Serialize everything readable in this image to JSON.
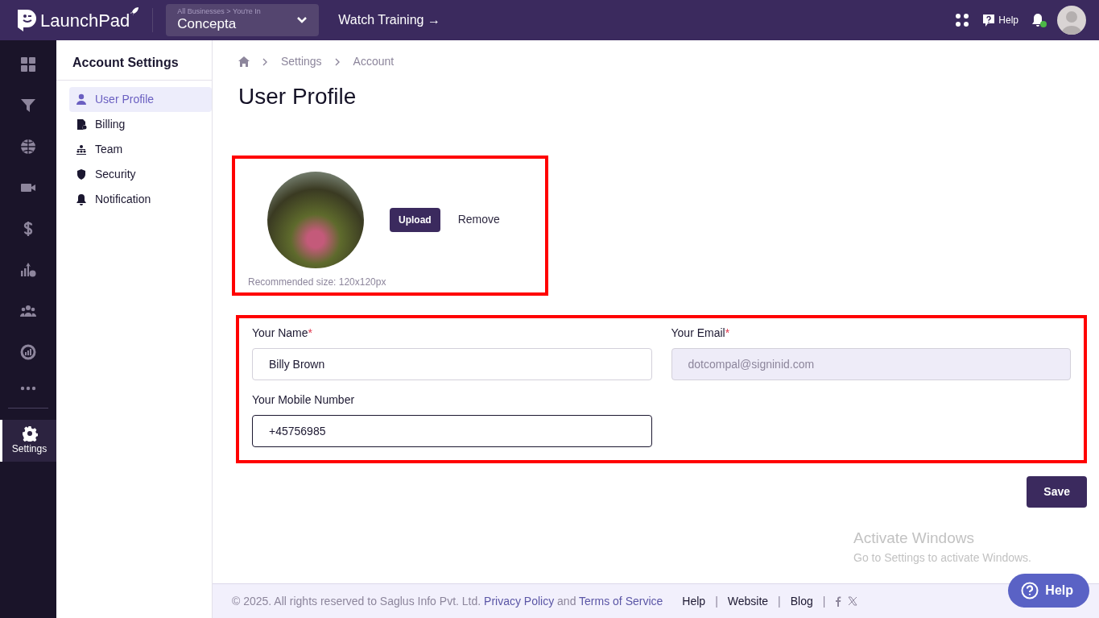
{
  "topbar": {
    "brand": "LaunchPad",
    "business_switcher": {
      "caption": "All Businesses > You're In",
      "value": "Concepta"
    },
    "training_link": "Watch Training →",
    "help": "Help",
    "notification_dot": true
  },
  "rail": {
    "items": [
      {
        "selected": false
      },
      {
        "selected": false
      },
      {
        "selected": false
      },
      {
        "selected": false
      },
      {
        "selected": false
      },
      {
        "selected": false
      },
      {
        "selected": false
      },
      {
        "selected": false
      },
      {
        "selected": false
      }
    ],
    "settings": {
      "label": "Settings",
      "selected": true
    }
  },
  "settings_menu": {
    "title": "Account Settings",
    "items": [
      {
        "label": "User Profile",
        "selected": true
      },
      {
        "label": "Billing",
        "selected": false
      },
      {
        "label": "Team",
        "selected": false
      },
      {
        "label": "Security",
        "selected": false
      },
      {
        "label": "Notification",
        "selected": false
      }
    ]
  },
  "breadcrumb": [
    "Settings",
    "Account"
  ],
  "page_title": "User Profile",
  "photo": {
    "upload": "Upload",
    "remove": "Remove",
    "hint": "Recommended size: 120x120px"
  },
  "form": {
    "required_marker": "*",
    "fields": [
      {
        "label": "Your Name",
        "required": true,
        "value": "Billy Brown",
        "disabled": false
      },
      {
        "label": "Your Email",
        "required": true,
        "value": "dotcompal@signinid.com",
        "disabled": true
      },
      {
        "label": "Your Mobile Number",
        "required": false,
        "value": "+45756985",
        "disabled": false
      }
    ],
    "save": "Save"
  },
  "os_notice": {
    "title": "Activate Windows",
    "text": "Go to Settings to activate Windows."
  },
  "footer": {
    "copyright": "©  2025. All rights reserved to Saglus Info Pvt. Ltd.",
    "privacy": "Privacy Policy",
    "and": "and",
    "terms": "Terms of Service",
    "links": [
      "Help",
      "Website",
      "Blog"
    ],
    "separator": "|"
  },
  "help_button": "Help"
}
